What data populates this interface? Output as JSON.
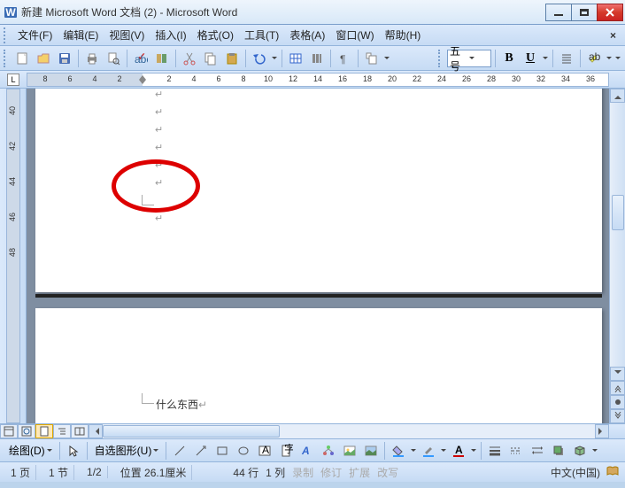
{
  "title": "新建 Microsoft Word 文档 (2) - Microsoft Word",
  "menu": {
    "file": "文件(F)",
    "edit": "编辑(E)",
    "view": "视图(V)",
    "insert": "插入(I)",
    "format": "格式(O)",
    "tools": "工具(T)",
    "table": "表格(A)",
    "window": "窗口(W)",
    "help": "帮助(H)"
  },
  "toolbar": {
    "font_size": "五号",
    "bold": "B",
    "underline": "U"
  },
  "ruler": {
    "corner": "L",
    "nums": [
      "8",
      "6",
      "4",
      "2",
      "2",
      "4",
      "6",
      "8",
      "10",
      "12",
      "14",
      "16",
      "18",
      "20",
      "22",
      "24",
      "26",
      "28",
      "30",
      "32",
      "34",
      "36"
    ]
  },
  "vruler": {
    "nums": [
      "40",
      "42",
      "44",
      "46",
      "48"
    ]
  },
  "doc": {
    "footer_text": "什么东西"
  },
  "drawbar": {
    "draw": "绘图(D)",
    "autoshape": "自选图形(U)"
  },
  "status": {
    "page": "1 页",
    "section": "1 节",
    "pages": "1/2",
    "position": "位置 26.1厘米",
    "line": "44 行",
    "col": "1 列",
    "rec": "录制",
    "rev": "修订",
    "ext": "扩展",
    "ovr": "改写",
    "lang": "中文(中国)"
  }
}
